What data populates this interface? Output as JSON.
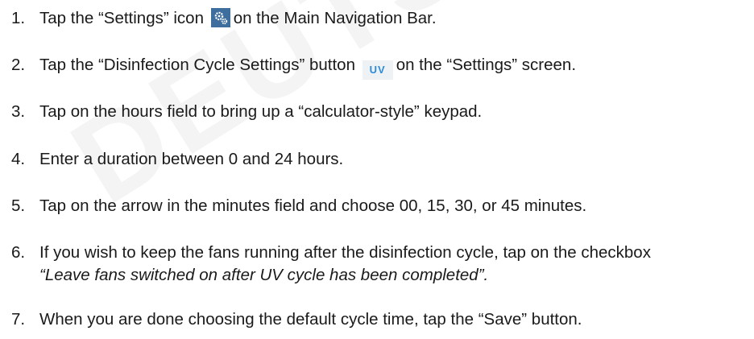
{
  "watermark": "DEUTSCHER",
  "steps": [
    {
      "num": "1.",
      "before": "Tap the “Settings” icon",
      "after": "on the Main Navigation Bar."
    },
    {
      "num": "2.",
      "before": "Tap the “Disinfection Cycle Settings” button",
      "button_label": "UV",
      "after": "on the “Settings” screen."
    },
    {
      "num": "3.",
      "text": "Tap on the hours field to bring up a “calculator-style” keypad."
    },
    {
      "num": "4.",
      "text": "Enter a duration between 0 and 24 hours."
    },
    {
      "num": "5.",
      "text": "Tap on the arrow in the minutes field and choose 00, 15, 30, or 45 minutes."
    },
    {
      "num": "6.",
      "text": "If you wish to keep the fans running after the disinfection cycle, tap on the checkbox",
      "italic": "“Leave fans switched on after UV cycle has been completed”."
    },
    {
      "num": "7.",
      "text": "When you are done choosing the default cycle time, tap the “Save” button."
    }
  ],
  "icons": {
    "settings": "gears-icon",
    "settings_bg": "#3d6e9e"
  }
}
